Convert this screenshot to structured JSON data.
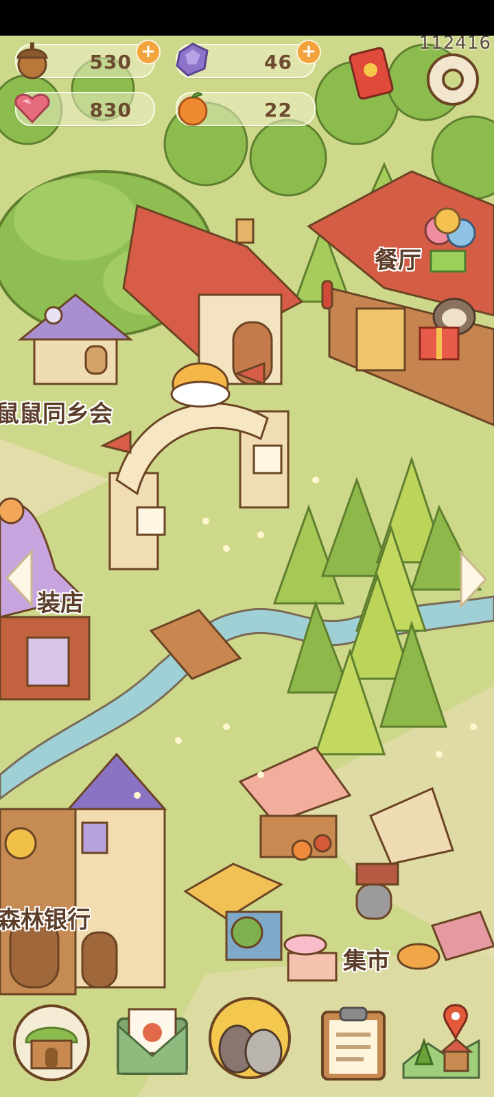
{
  "resources": {
    "acorn": {
      "value": "530",
      "icon": "acorn-icon"
    },
    "gem": {
      "value": "46",
      "icon": "purple-gem-icon"
    },
    "heart": {
      "value": "830",
      "icon": "heart-gem-icon"
    },
    "fruit": {
      "value": "22",
      "icon": "orange-fruit-icon"
    }
  },
  "player_id": "112416",
  "buildings": {
    "restaurant": "餐厅",
    "hamster_club": "鼠鼠同乡会",
    "clothing_store": "装店",
    "forest_bank": "森林银行",
    "market": "集市"
  },
  "colors": {
    "grass": "#cdd88a",
    "river": "#a9d6d8",
    "label_text": "#5b3d2a",
    "plus_badge": "#f2a33c"
  },
  "bottom_nav": [
    {
      "name": "home-house-button",
      "icon": "treehouse-icon"
    },
    {
      "name": "mail-button",
      "icon": "letter-icon"
    },
    {
      "name": "character-button",
      "icon": "birds-icon"
    },
    {
      "name": "tasks-button",
      "icon": "clipboard-icon"
    },
    {
      "name": "map-button",
      "icon": "map-pin-icon"
    }
  ]
}
